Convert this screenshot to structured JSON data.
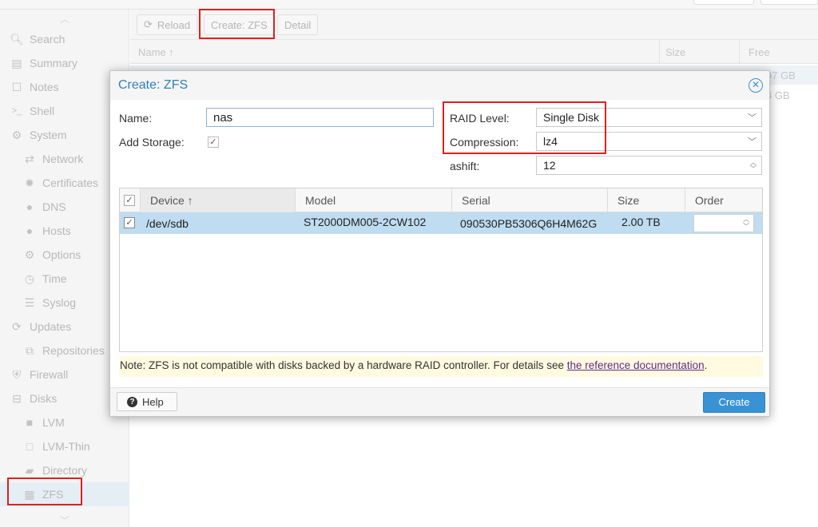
{
  "sidebar": {
    "items": [
      {
        "label": "Search",
        "icon": "search-icon",
        "glyph": "🔍︎"
      },
      {
        "label": "Summary",
        "icon": "book-icon",
        "glyph": "▤"
      },
      {
        "label": "Notes",
        "icon": "notes-icon",
        "glyph": "☐"
      },
      {
        "label": "Shell",
        "icon": "terminal-icon",
        "glyph": ">_"
      },
      {
        "label": "System",
        "icon": "gears-icon",
        "glyph": "⚙"
      },
      {
        "label": "Network",
        "icon": "network-icon",
        "glyph": "⇄"
      },
      {
        "label": "Certificates",
        "icon": "certificate-icon",
        "glyph": "✹"
      },
      {
        "label": "DNS",
        "icon": "globe-icon",
        "glyph": "●"
      },
      {
        "label": "Hosts",
        "icon": "globe-icon",
        "glyph": "●"
      },
      {
        "label": "Options",
        "icon": "gear-icon",
        "glyph": "⚙"
      },
      {
        "label": "Time",
        "icon": "clock-icon",
        "glyph": "◷"
      },
      {
        "label": "Syslog",
        "icon": "list-icon",
        "glyph": "☰"
      },
      {
        "label": "Updates",
        "icon": "refresh-icon",
        "glyph": "⟳"
      },
      {
        "label": "Repositories",
        "icon": "repositories-icon",
        "glyph": "⧉"
      },
      {
        "label": "Firewall",
        "icon": "shield-icon",
        "glyph": "⛨"
      },
      {
        "label": "Disks",
        "icon": "hdd-icon",
        "glyph": "⊟"
      },
      {
        "label": "LVM",
        "icon": "square-icon",
        "glyph": "■"
      },
      {
        "label": "LVM-Thin",
        "icon": "square-outline-icon",
        "glyph": "□"
      },
      {
        "label": "Directory",
        "icon": "folder-icon",
        "glyph": "▰"
      },
      {
        "label": "ZFS",
        "icon": "grid-icon",
        "glyph": "▦"
      }
    ]
  },
  "toolbar": {
    "reload_label": "Reload",
    "create_zfs_label": "Create: ZFS",
    "detail_label": "Detail"
  },
  "background_grid": {
    "columns": {
      "name": "Name ↑",
      "size": "Size",
      "free": "Free"
    },
    "rows": [
      {
        "free": "97 GB"
      },
      {
        "free": "4 GB"
      }
    ]
  },
  "dialog": {
    "title": "Create: ZFS",
    "name_label": "Name:",
    "name_value": "nas",
    "add_storage_label": "Add Storage:",
    "add_storage_checked": true,
    "raid_level_label": "RAID Level:",
    "raid_level_value": "Single Disk",
    "compression_label": "Compression:",
    "compression_value": "lz4",
    "ashift_label": "ashift:",
    "ashift_value": "12",
    "disk_table": {
      "columns": [
        "Device ↑",
        "Model",
        "Serial",
        "Size",
        "Order"
      ],
      "rows": [
        {
          "checked": true,
          "device": "/dev/sdb",
          "model": "ST2000DM005-2CW102",
          "serial": "090530PB5306Q6H4M62G",
          "size": "2.00 TB",
          "order": ""
        }
      ]
    },
    "note_text": "Note: ZFS is not compatible with disks backed by a hardware RAID controller. For details see ",
    "note_link": "the reference documentation",
    "note_end": ".",
    "help_label": "Help",
    "create_label": "Create"
  },
  "colors": {
    "accent": "#3892d4",
    "title_blue": "#2f7fbf",
    "selected_row": "#bfdcf0",
    "highlight_red": "#e0201e",
    "note_bg": "#fffae0"
  }
}
